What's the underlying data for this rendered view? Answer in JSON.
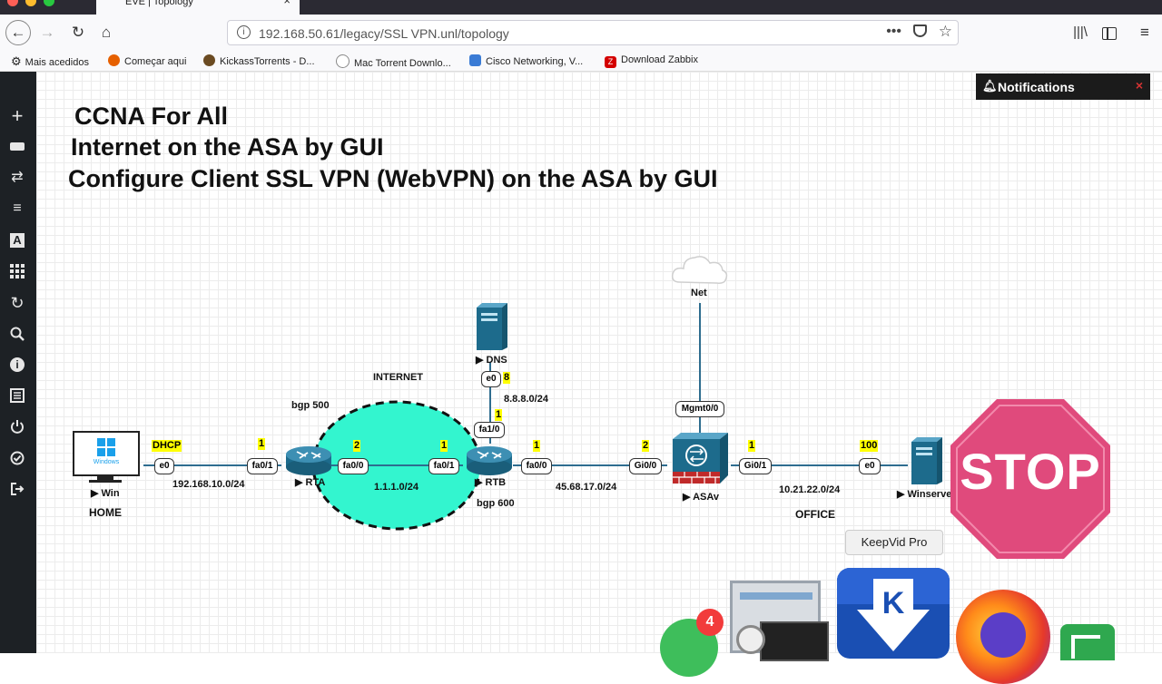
{
  "browser": {
    "tab_title": "EVE | Topology",
    "url": "192.168.50.61/legacy/SSL VPN.unl/topology",
    "bookmarks": [
      {
        "label": "Mais acedidos",
        "color": "#444"
      },
      {
        "label": "Começar aqui",
        "color": "#e66000"
      },
      {
        "label": "KickassTorrents - D...",
        "color": "#6b4b22"
      },
      {
        "label": "Mac Torrent Downlo...",
        "color": "#888"
      },
      {
        "label": "Cisco Networking, V...",
        "color": "#3a7bd5"
      },
      {
        "label": "Download Zabbix",
        "color": "#d40000"
      }
    ]
  },
  "notifications": {
    "label": "Notifications",
    "close": "×"
  },
  "titles": [
    "CCNA For All",
    "Internet on the ASA by GUI",
    "Configure Client SSL VPN (WebVPN) on the ASA by GUI"
  ],
  "topology": {
    "nodes": {
      "win": "Win",
      "rta": "RTA",
      "rtb": "RTB",
      "dns": "DNS",
      "asav": "ASAv",
      "winserver": "Winserver",
      "net": "Net",
      "windows_logo": "Windows"
    },
    "ports": {
      "win_e0": "e0",
      "rta_fa01": "fa0/1",
      "rta_fa00": "fa0/0",
      "rtb_fa01": "fa0/1",
      "rtb_fa10": "fa1/0",
      "rtb_fa00": "fa0/0",
      "dns_e0": "e0",
      "asa_gi00": "Gi0/0",
      "asa_gi01": "Gi0/1",
      "asa_mgmt": "Mgmt0/0",
      "winserver_e0": "e0"
    },
    "host_ids": {
      "dhcp": "DHCP",
      "rta_left": "1",
      "rta_right": "2",
      "rtb_left": "1",
      "rtb_top": "1",
      "rtb_right": "1",
      "asa_left": "2",
      "asa_right": "1",
      "dns": "8",
      "winserver": "100"
    },
    "labels": {
      "home": "HOME",
      "office": "OFFICE",
      "internet": "INTERNET",
      "bgp500": "bgp 500",
      "bgp600": "bgp 600",
      "net1": "192.168.10.0/24",
      "net2": "1.1.1.0/24",
      "net3": "8.8.8.0/24",
      "net4": "45.68.17.0/24",
      "net5": "10.21.22.0/24"
    }
  },
  "overlay": {
    "stop_text": "STOP",
    "keepvid_tooltip": "KeepVid Pro",
    "whatsapp_badge": "4",
    "keepvid_letter": "K"
  }
}
